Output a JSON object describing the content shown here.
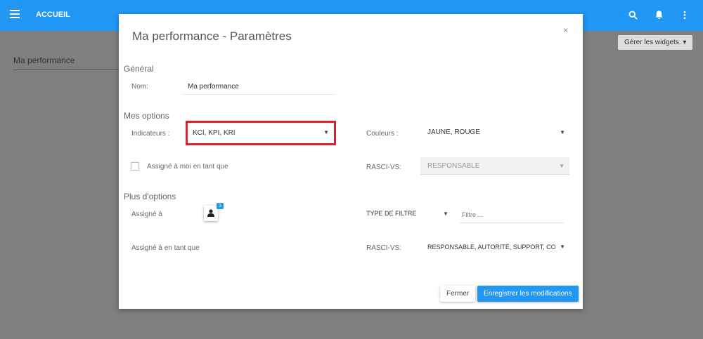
{
  "topbar": {
    "title": "ACCUEIL",
    "icons": [
      "menu-icon",
      "search-icon",
      "bell-icon",
      "more-vert-icon"
    ]
  },
  "background": {
    "page_title": "Ma performance",
    "manage_widgets": "Gérer les widgets."
  },
  "modal": {
    "title": "Ma performance - Paramètres",
    "close": "×",
    "general": {
      "heading": "Général",
      "name_label": "Nom:",
      "name_value": "Ma performance"
    },
    "options": {
      "heading": "Mes options",
      "indicators_label": "Indicateurs :",
      "indicators_value": "KCI, KPI, KRI",
      "colors_label": "Couleurs :",
      "colors_value": "JAUNE, ROUGE",
      "assigned_me_label": "Assigné à moi en tant que",
      "assigned_me_checked": false,
      "rasci_label": "RASCI-VS:",
      "rasci_value": "RESPONSABLE"
    },
    "more": {
      "heading": "Plus d'options",
      "assigned_to_label": "Assigné à",
      "assigned_count": "3",
      "filter_type": "TYPE DE FILTRE",
      "filter_placeholder": "Filtre ...",
      "assigned_as_label": "Assigné à en tant que",
      "rasci_label": "RASCI-VS:",
      "rasci_value": "RESPONSABLE, AUTORITÉ, SUPPORT, CONS"
    },
    "buttons": {
      "close": "Fermer",
      "save": "Enregistrer les modifications"
    }
  },
  "colors": {
    "primary": "#2196f3",
    "highlight": "#d9232d"
  }
}
